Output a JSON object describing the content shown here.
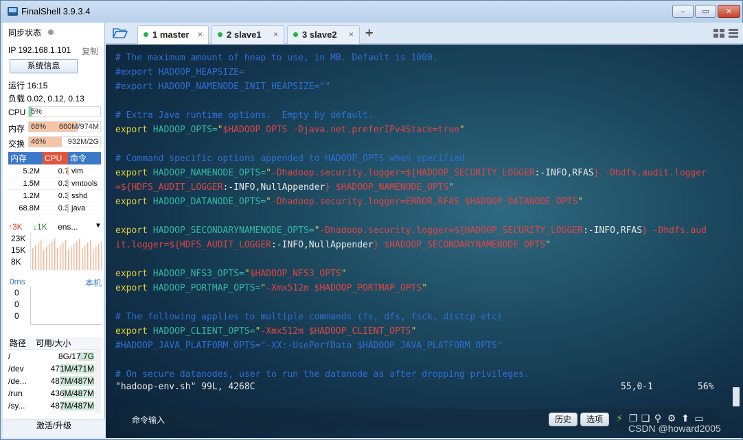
{
  "window": {
    "title": "FinalShell 3.9.3.4",
    "min": "–",
    "max": "▭",
    "close": "✕"
  },
  "sidebar": {
    "sync_label": "同步状态",
    "ip": "IP 192.168.1.101",
    "copy": "复制",
    "sysinfo_button": "系统信息",
    "uptime": "运行 16:15",
    "load": "负载 0.02, 0.12, 0.13",
    "cpu": {
      "label": "CPU",
      "percent": "5%",
      "fill": 0.05
    },
    "mem": {
      "label": "内存",
      "percent": "68%",
      "amount": "660M/974M",
      "fill": 0.68
    },
    "swap": {
      "label": "交换",
      "percent": "46%",
      "amount": "932M/2G",
      "fill": 0.46
    },
    "proc_headers": [
      "内存",
      "CPU",
      "命令"
    ],
    "processes": [
      {
        "mem": "5.2M",
        "cpu": "0.7",
        "cmd": "vim"
      },
      {
        "mem": "1.5M",
        "cpu": "0.3",
        "cmd": "vmtools"
      },
      {
        "mem": "1.2M",
        "cpu": "0.3",
        "cmd": "sshd"
      },
      {
        "mem": "68.8M",
        "cpu": "0.3",
        "cmd": "java"
      }
    ],
    "net": {
      "up": "3K",
      "down": "1K",
      "iface": "ens...",
      "labels": [
        "23K",
        "15K",
        "8K"
      ]
    },
    "ping": {
      "ms": "0ms",
      "host": "本机",
      "values": [
        "0",
        "0",
        "0"
      ]
    },
    "disk_headers": [
      "路径",
      "可用/大小"
    ],
    "disks": [
      {
        "path": "/",
        "size": "8G/17.7G",
        "fill": 0.45
      },
      {
        "path": "/dev",
        "size": "471M/471M",
        "fill": 1.0
      },
      {
        "path": "/de...",
        "size": "487M/487M",
        "fill": 1.0
      },
      {
        "path": "/run",
        "size": "436M/487M",
        "fill": 0.9
      },
      {
        "path": "/sy...",
        "size": "487M/487M",
        "fill": 1.0
      },
      {
        "path": "/...",
        "size": "...",
        "fill": 0.3
      }
    ],
    "upgrade": "激活/升级"
  },
  "tabs": [
    {
      "label": "1 master",
      "close": "×"
    },
    {
      "label": "2 slave1",
      "close": "×"
    },
    {
      "label": "3 slave2",
      "close": "×"
    }
  ],
  "add_tab": "+",
  "terminal": {
    "lines": [
      [
        {
          "c": "t-comment",
          "t": "# The maximum amount of heap to use, in MB. Default is 1000."
        }
      ],
      [
        {
          "c": "t-comment",
          "t": "#export HADOOP_HEAPSIZE="
        }
      ],
      [
        {
          "c": "t-comment",
          "t": "#export HADOOP_NAMENODE_INIT_HEAPSIZE=\"\""
        }
      ],
      [],
      [
        {
          "c": "t-comment",
          "t": "# Extra Java runtime options.  Empty by default."
        }
      ],
      [
        {
          "c": "t-kw",
          "t": "export "
        },
        {
          "c": "t-var",
          "t": "HADOOP_OPTS="
        },
        {
          "c": "t-kw",
          "t": "\""
        },
        {
          "c": "t-str",
          "t": "$HADOOP_OPTS -Djava.net.preferIPv4Stack=true"
        },
        {
          "c": "t-kw",
          "t": "\""
        }
      ],
      [],
      [
        {
          "c": "t-comment",
          "t": "# Command specific options appended to HADOOP_OPTS when specified"
        }
      ],
      [
        {
          "c": "t-kw",
          "t": "export "
        },
        {
          "c": "t-var",
          "t": "HADOOP_NAMENODE_OPTS="
        },
        {
          "c": "t-kw",
          "t": "\""
        },
        {
          "c": "t-str",
          "t": "-Dhadoop.security.logger=${HADOOP_SECURITY_LOGGER"
        },
        {
          "c": "t-plain",
          "t": ":-INFO,RFAS"
        },
        {
          "c": "t-str",
          "t": "} -Dhdfs.audit.logger"
        }
      ],
      [
        {
          "c": "t-str",
          "t": "=${HDFS_AUDIT_LOGGER"
        },
        {
          "c": "t-plain",
          "t": ":-INFO,NullAppender"
        },
        {
          "c": "t-str",
          "t": "} $HADOOP_NAMENODE_OPTS"
        },
        {
          "c": "t-kw",
          "t": "\""
        }
      ],
      [
        {
          "c": "t-kw",
          "t": "export "
        },
        {
          "c": "t-var",
          "t": "HADOOP_DATANODE_OPTS="
        },
        {
          "c": "t-kw",
          "t": "\""
        },
        {
          "c": "t-str",
          "t": "-Dhadoop.security.logger=ERROR,RFAS $HADOOP_DATANODE_OPTS"
        },
        {
          "c": "t-kw",
          "t": "\""
        }
      ],
      [],
      [
        {
          "c": "t-kw",
          "t": "export "
        },
        {
          "c": "t-var",
          "t": "HADOOP_SECONDARYNAMENODE_OPTS="
        },
        {
          "c": "t-kw",
          "t": "\""
        },
        {
          "c": "t-str",
          "t": "-Dhadoop.security.logger=${HADOOP_SECURITY_LOGGER"
        },
        {
          "c": "t-plain",
          "t": ":-INFO,RFAS"
        },
        {
          "c": "t-str",
          "t": "} -Dhdfs.aud"
        }
      ],
      [
        {
          "c": "t-str",
          "t": "it.logger=${HDFS_AUDIT_LOGGER"
        },
        {
          "c": "t-plain",
          "t": ":-INFO,NullAppender"
        },
        {
          "c": "t-str",
          "t": "} $HADOOP_SECONDARYNAMENODE_OPTS"
        },
        {
          "c": "t-kw",
          "t": "\""
        }
      ],
      [],
      [
        {
          "c": "t-kw",
          "t": "export "
        },
        {
          "c": "t-var",
          "t": "HADOOP_NFS3_OPTS="
        },
        {
          "c": "t-kw",
          "t": "\""
        },
        {
          "c": "t-str",
          "t": "$HADOOP_NFS3_OPTS"
        },
        {
          "c": "t-kw",
          "t": "\""
        }
      ],
      [
        {
          "c": "t-kw",
          "t": "export "
        },
        {
          "c": "t-var",
          "t": "HADOOP_PORTMAP_OPTS="
        },
        {
          "c": "t-kw",
          "t": "\""
        },
        {
          "c": "t-str",
          "t": "-Xmx512m $HADOOP_PORTMAP_OPTS"
        },
        {
          "c": "t-kw",
          "t": "\""
        }
      ],
      [],
      [
        {
          "c": "t-comment",
          "t": "# The following applies to multiple commands (fs, dfs, fsck, distcp etc)"
        }
      ],
      [
        {
          "c": "t-kw",
          "t": "export "
        },
        {
          "c": "t-var",
          "t": "HADOOP_CLIENT_OPTS="
        },
        {
          "c": "t-kw",
          "t": "\""
        },
        {
          "c": "t-str",
          "t": "-Xmx512m $HADOOP_CLIENT_OPTS"
        },
        {
          "c": "t-kw",
          "t": "\""
        }
      ],
      [
        {
          "c": "t-comment",
          "t": "#HADOOP_JAVA_PLATFORM_OPTS=\"-XX:-UsePerfData $HADOOP_JAVA_PLATFORM_OPTS\""
        }
      ],
      [],
      [
        {
          "c": "t-comment",
          "t": "# On secure datanodes, user to run the datanode as after dropping privileges."
        }
      ]
    ],
    "status_file": "\"hadoop-env.sh\" 99L, 4268C",
    "status_pos": "55,0-1",
    "status_pct": "56%"
  },
  "command_bar": {
    "label": "命令输入",
    "history": "历史",
    "options": "选项"
  },
  "watermark": "CSDN @howard2005"
}
